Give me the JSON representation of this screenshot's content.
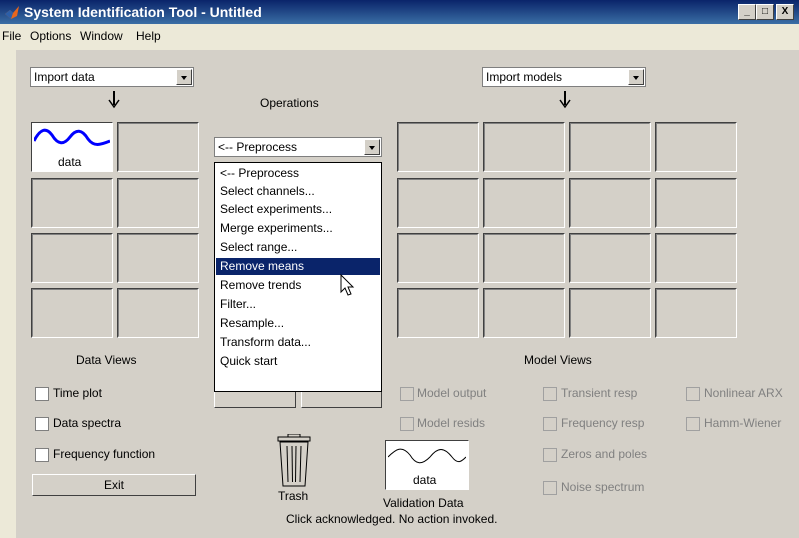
{
  "window": {
    "title": "System Identification Tool - Untitled",
    "controls": [
      "_",
      "□",
      "X"
    ]
  },
  "menubar": {
    "items": [
      "File",
      "Options",
      "Window",
      "Help"
    ]
  },
  "left_panel": {
    "import_data_label": "Import data",
    "data_icon_label": "data",
    "views_title": "Data Views",
    "checkboxes": [
      {
        "label": "Time plot",
        "checked": false
      },
      {
        "label": "Data spectra",
        "checked": false
      },
      {
        "label": "Frequency function",
        "checked": false
      }
    ],
    "exit_label": "Exit"
  },
  "operations": {
    "title": "Operations",
    "selected": "<-- Preprocess",
    "options": [
      "<-- Preprocess",
      "Select channels...",
      "Select experiments...",
      "Merge experiments...",
      "Select range...",
      "Remove means",
      "Remove trends",
      "Filter...",
      "Resample...",
      "Transform data...",
      "Quick start"
    ],
    "highlighted": "Remove means"
  },
  "right_panel": {
    "import_models_label": "Import models",
    "views_title": "Model Views",
    "checkboxes": [
      {
        "label": "Model output",
        "enabled": false
      },
      {
        "label": "Model resids",
        "enabled": false
      },
      {
        "label": "Transient resp",
        "enabled": false
      },
      {
        "label": "Frequency resp",
        "enabled": false
      },
      {
        "label": "Zeros and poles",
        "enabled": false
      },
      {
        "label": "Noise spectrum",
        "enabled": false
      },
      {
        "label": "Nonlinear ARX",
        "enabled": false
      },
      {
        "label": "Hamm-Wiener",
        "enabled": false
      }
    ]
  },
  "bottom": {
    "trash_label": "Trash",
    "validation_icon_label": "data",
    "validation_label": "Validation Data",
    "status_text": "Click acknowledged. No action invoked."
  },
  "colors": {
    "titlebar": "#0a246a",
    "selection": "#0a246a",
    "signal": "#0000ff",
    "panel": "#d4d0c8"
  }
}
